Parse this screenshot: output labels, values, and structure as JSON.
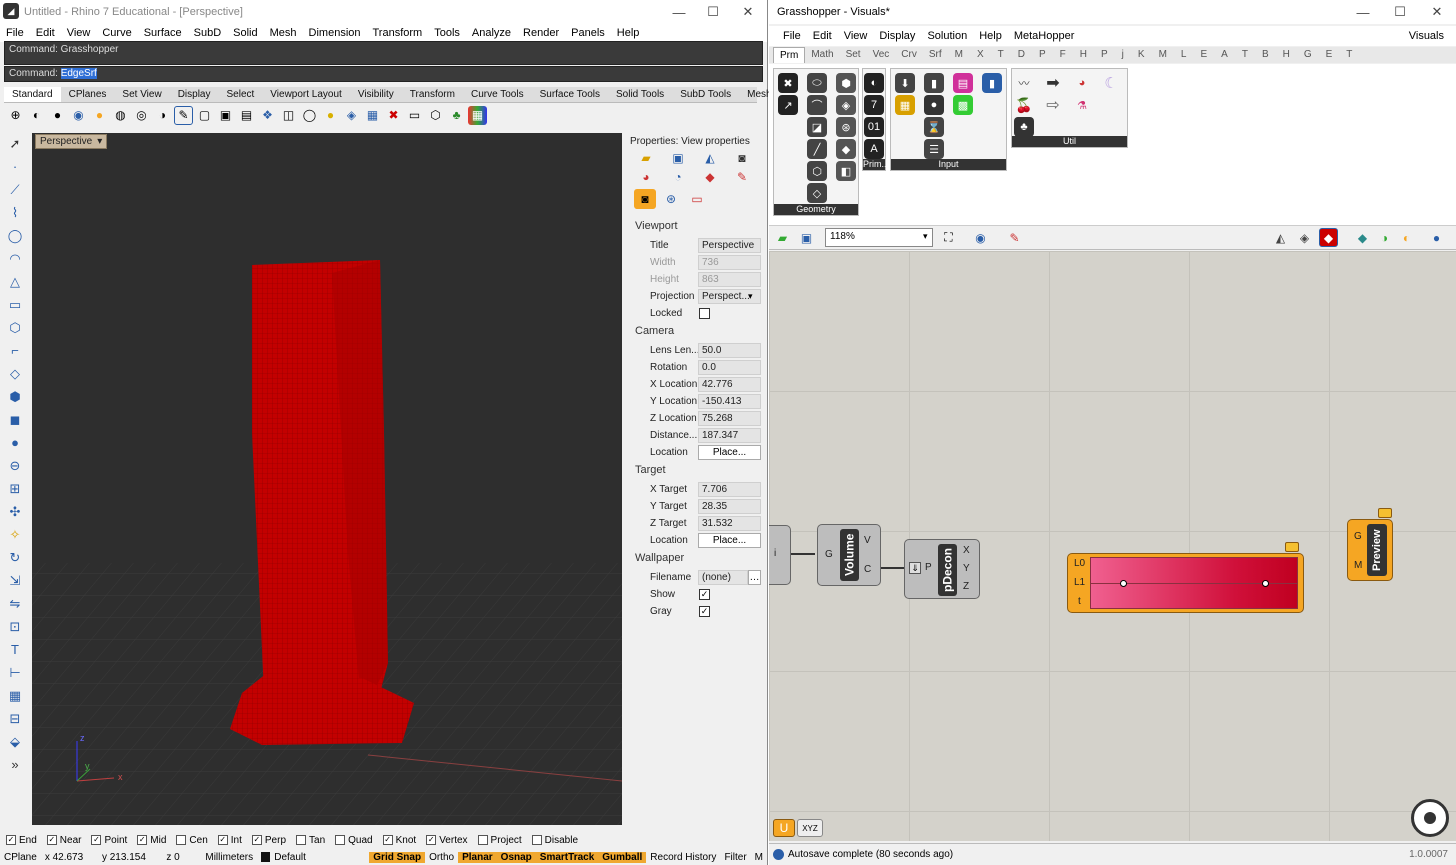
{
  "rhino": {
    "title": "Untitled - Rhino 7 Educational - [Perspective]",
    "menu": [
      "File",
      "Edit",
      "View",
      "Curve",
      "Surface",
      "SubD",
      "Solid",
      "Mesh",
      "Dimension",
      "Transform",
      "Tools",
      "Analyze",
      "Render",
      "Panels",
      "Help"
    ],
    "command_history": "Command: Grasshopper",
    "command_prompt": "Command:",
    "command_value": "EdgeSrf",
    "toolbar_tabs": [
      "Standard",
      "CPlanes",
      "Set View",
      "Display",
      "Select",
      "Viewport Layout",
      "Visibility",
      "Transform",
      "Curve Tools",
      "Surface Tools",
      "Solid Tools",
      "SubD Tools",
      "Mesh"
    ],
    "viewport_tab": "Perspective",
    "axes": {
      "x": "x",
      "y": "y",
      "z": "z"
    },
    "properties": {
      "header": "Properties: View properties",
      "viewport_section": "Viewport",
      "title_label": "Title",
      "title_value": "Perspective",
      "width_label": "Width",
      "width_value": "736",
      "height_label": "Height",
      "height_value": "863",
      "projection_label": "Projection",
      "projection_value": "Perspect...",
      "locked_label": "Locked",
      "camera_section": "Camera",
      "lens_label": "Lens Len...",
      "lens_value": "50.0",
      "rotation_label": "Rotation",
      "rotation_value": "0.0",
      "xloc_label": "X Location",
      "xloc_value": "42.776",
      "yloc_label": "Y Location",
      "yloc_value": "-150.413",
      "zloc_label": "Z Location",
      "zloc_value": "75.268",
      "distance_label": "Distance...",
      "distance_value": "187.347",
      "location_label": "Location",
      "place_button": "Place...",
      "target_section": "Target",
      "xt_label": "X Target",
      "xt_value": "7.706",
      "yt_label": "Y Target",
      "yt_value": "28.35",
      "zt_label": "Z Target",
      "zt_value": "31.532",
      "tlocation_label": "Location",
      "wallpaper_section": "Wallpaper",
      "filename_label": "Filename",
      "filename_value": "(none)",
      "show_label": "Show",
      "gray_label": "Gray"
    },
    "osnaps": [
      {
        "label": "End",
        "checked": true
      },
      {
        "label": "Near",
        "checked": true
      },
      {
        "label": "Point",
        "checked": true
      },
      {
        "label": "Mid",
        "checked": true
      },
      {
        "label": "Cen",
        "checked": false
      },
      {
        "label": "Int",
        "checked": true
      },
      {
        "label": "Perp",
        "checked": true
      },
      {
        "label": "Tan",
        "checked": false
      },
      {
        "label": "Quad",
        "checked": false
      },
      {
        "label": "Knot",
        "checked": true
      },
      {
        "label": "Vertex",
        "checked": true
      },
      {
        "label": "Project",
        "checked": false
      },
      {
        "label": "Disable",
        "checked": false
      }
    ],
    "status": {
      "cplane": "CPlane",
      "x": "x 42.673",
      "y": "y 213.154",
      "z": "z 0",
      "units": "Millimeters",
      "layer": "Default",
      "grid_snap": "Grid Snap",
      "ortho": "Ortho",
      "planar": "Planar",
      "osnap": "Osnap",
      "smarttrack": "SmartTrack",
      "gumball": "Gumball",
      "record_history": "Record History",
      "filter": "Filter",
      "more": "M"
    }
  },
  "gh": {
    "title": "Grasshopper - Visuals*",
    "menu": [
      "File",
      "Edit",
      "View",
      "Display",
      "Solution",
      "Help",
      "MetaHopper"
    ],
    "doc_name": "Visuals",
    "tabs": [
      "Prm",
      "Math",
      "Set",
      "Vec",
      "Crv",
      "Srf",
      "M",
      "X",
      "T",
      "D",
      "P",
      "F",
      "H",
      "P",
      "j",
      "K",
      "M",
      "L",
      "E",
      "A",
      "T",
      "B",
      "H",
      "G",
      "E",
      "T"
    ],
    "groups": {
      "geometry": "Geometry",
      "primitive": "Prim...",
      "input": "Input",
      "util": "Util"
    },
    "zoom": "118%",
    "components": {
      "volume": {
        "name": "Volume",
        "in": "G",
        "out1": "V",
        "out2": "C"
      },
      "pdecon": {
        "name": "pDecon",
        "in": "P",
        "out1": "X",
        "out2": "Y",
        "out3": "Z"
      },
      "gradient": {
        "in1": "L0",
        "in2": "L1",
        "in3": "t"
      },
      "preview": {
        "name": "Preview",
        "in1": "G",
        "in2": "M"
      },
      "left_partial": "i"
    },
    "status": "Autosave complete (80 seconds ago)",
    "version": "1.0.0007"
  },
  "colors": {
    "surface_red": "#c00000",
    "gh_orange": "#f5a623",
    "accent_blue": "#2f6fd6"
  }
}
